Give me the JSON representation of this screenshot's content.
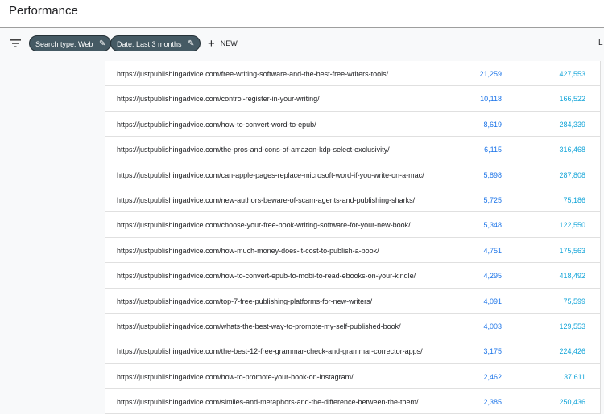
{
  "header": {
    "title": "Performance"
  },
  "toolbar": {
    "chips": [
      {
        "label": "Search type: Web"
      },
      {
        "label": "Date: Last 3 months"
      }
    ],
    "new_label": "NEW",
    "truncated_label": "L"
  },
  "colors": {
    "clicks": "#1a73e8",
    "impressions": "#12a4d8",
    "chip": "#455a64"
  },
  "rows": [
    {
      "url": "https://justpublishingadvice.com/free-writing-software-and-the-best-free-writers-tools/",
      "clicks": "21,259",
      "impressions": "427,553"
    },
    {
      "url": "https://justpublishingadvice.com/control-register-in-your-writing/",
      "clicks": "10,118",
      "impressions": "166,522"
    },
    {
      "url": "https://justpublishingadvice.com/how-to-convert-word-to-epub/",
      "clicks": "8,619",
      "impressions": "284,339"
    },
    {
      "url": "https://justpublishingadvice.com/the-pros-and-cons-of-amazon-kdp-select-exclusivity/",
      "clicks": "6,115",
      "impressions": "316,468"
    },
    {
      "url": "https://justpublishingadvice.com/can-apple-pages-replace-microsoft-word-if-you-write-on-a-mac/",
      "clicks": "5,898",
      "impressions": "287,808"
    },
    {
      "url": "https://justpublishingadvice.com/new-authors-beware-of-scam-agents-and-publishing-sharks/",
      "clicks": "5,725",
      "impressions": "75,186"
    },
    {
      "url": "https://justpublishingadvice.com/choose-your-free-book-writing-software-for-your-new-book/",
      "clicks": "5,348",
      "impressions": "122,550"
    },
    {
      "url": "https://justpublishingadvice.com/how-much-money-does-it-cost-to-publish-a-book/",
      "clicks": "4,751",
      "impressions": "175,563"
    },
    {
      "url": "https://justpublishingadvice.com/how-to-convert-epub-to-mobi-to-read-ebooks-on-your-kindle/",
      "clicks": "4,295",
      "impressions": "418,492"
    },
    {
      "url": "https://justpublishingadvice.com/top-7-free-publishing-platforms-for-new-writers/",
      "clicks": "4,091",
      "impressions": "75,599"
    },
    {
      "url": "https://justpublishingadvice.com/whats-the-best-way-to-promote-my-self-published-book/",
      "clicks": "4,003",
      "impressions": "129,553"
    },
    {
      "url": "https://justpublishingadvice.com/the-best-12-free-grammar-check-and-grammar-corrector-apps/",
      "clicks": "3,175",
      "impressions": "224,426"
    },
    {
      "url": "https://justpublishingadvice.com/how-to-promote-your-book-on-instagram/",
      "clicks": "2,462",
      "impressions": "37,611"
    },
    {
      "url": "https://justpublishingadvice.com/similes-and-metaphors-and-the-difference-between-the-them/",
      "clicks": "2,385",
      "impressions": "250,436"
    }
  ]
}
